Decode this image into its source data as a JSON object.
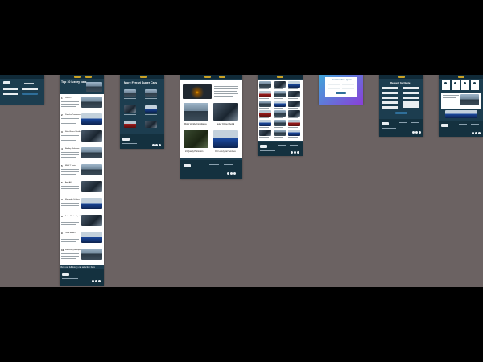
{
  "canvas": {
    "background": "#6b6262",
    "letterbox": "#000000"
  },
  "boards": {
    "login": {
      "title": "",
      "button": ""
    },
    "top10": {
      "title": "Top 10 luxury cars",
      "items": [
        "Lexus LS",
        "Porsche Panamera",
        "Rolls-Royce Wraith",
        "Bentley Mulsanne",
        "BMW 7 Series",
        "Audi A8",
        "Mercedes S-Class",
        "Aston Martin Rapide",
        "Tesla Model S",
        "Maserati Quattroporte"
      ],
      "cta": "View our full luxury car selection here",
      "footer_logo": "SHCC"
    },
    "supercars": {
      "title": "More Ferrari Super Cars",
      "footer_logo": "SHCC"
    },
    "article": {
      "captions": [
        "Motor Vehicle Compliance",
        "Super Clipper Rental",
        "24 Quality Promotion",
        "Our Luxury car Services"
      ],
      "footer_logo": "SHCC"
    },
    "inventory": {
      "footer_logo": "SHCC"
    },
    "popup": {
      "title": "Get Your Free Quote",
      "accent_from": "#3fa6d9",
      "accent_to": "#8a3fd9"
    },
    "contact": {
      "title": "Request for Quote",
      "button": "Submit",
      "footer_logo": "SHCC"
    },
    "services": {
      "footer_logo": "SHCC"
    }
  }
}
